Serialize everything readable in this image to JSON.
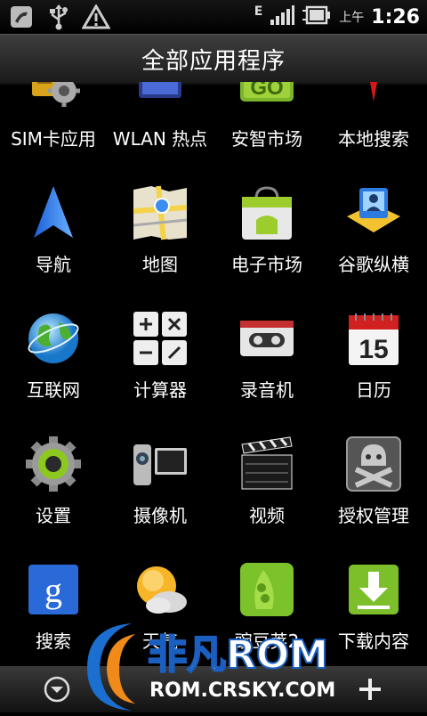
{
  "status_bar": {
    "network": "E",
    "ampm": "上午",
    "time": "1:26",
    "icons": [
      "dnd-icon",
      "usb-icon",
      "warning-icon",
      "signal-icon",
      "battery-icon"
    ]
  },
  "header": {
    "title": "全部应用程序"
  },
  "apps": [
    {
      "label": "SIM卡应用",
      "icon": "sim-toolkit-icon"
    },
    {
      "label": "WLAN 热点",
      "icon": "wifi-hotspot-icon"
    },
    {
      "label": "安智市场",
      "icon": "anzhi-market-icon"
    },
    {
      "label": "本地搜索",
      "icon": "local-search-icon"
    },
    {
      "label": "导航",
      "icon": "navigation-icon"
    },
    {
      "label": "地图",
      "icon": "maps-icon"
    },
    {
      "label": "电子市场",
      "icon": "android-market-icon"
    },
    {
      "label": "谷歌纵横",
      "icon": "latitude-icon"
    },
    {
      "label": "互联网",
      "icon": "browser-globe-icon"
    },
    {
      "label": "计算器",
      "icon": "calculator-icon"
    },
    {
      "label": "录音机",
      "icon": "voice-recorder-icon"
    },
    {
      "label": "日历",
      "icon": "calendar-icon"
    },
    {
      "label": "设置",
      "icon": "settings-gear-icon"
    },
    {
      "label": "摄像机",
      "icon": "camcorder-icon"
    },
    {
      "label": "视频",
      "icon": "video-clapper-icon"
    },
    {
      "label": "授权管理",
      "icon": "superuser-icon"
    },
    {
      "label": "搜索",
      "icon": "google-search-icon"
    },
    {
      "label": "天气",
      "icon": "weather-icon"
    },
    {
      "label": "豌豆荚2",
      "icon": "wandoujia-icon"
    },
    {
      "label": "下载内容",
      "icon": "downloads-icon"
    }
  ],
  "calendar_day": "15",
  "watermark": {
    "brand": "非凡ROM",
    "url": "ROM.CRSKY.COM"
  },
  "bottom_bar": {
    "left_icon": "collapse-down-icon",
    "right_icon": "add-plus-icon"
  }
}
